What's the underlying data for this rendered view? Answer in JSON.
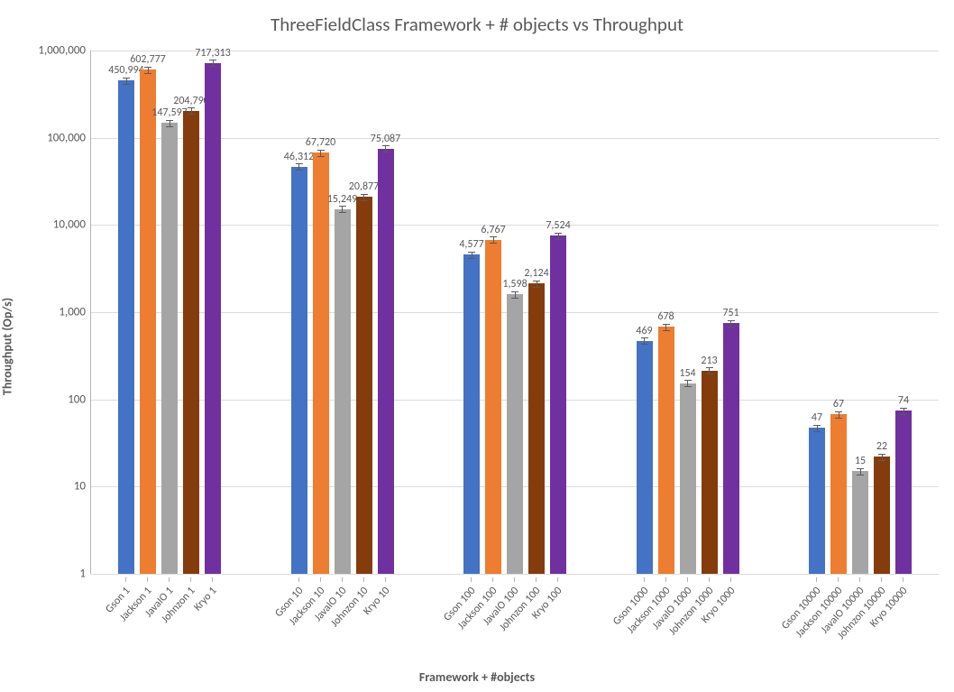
{
  "chart_data": {
    "type": "bar",
    "title": "ThreeFieldClass Framework + # objects vs Throughput",
    "xlabel": "Framework + #objects",
    "ylabel": "Throughput (Op/s)",
    "y_scale": "log",
    "ylim": [
      1,
      1000000
    ],
    "y_ticks": [
      {
        "v": 1,
        "label": "1"
      },
      {
        "v": 10,
        "label": "10"
      },
      {
        "v": 100,
        "label": "100"
      },
      {
        "v": 1000,
        "label": "1,000"
      },
      {
        "v": 10000,
        "label": "10,000"
      },
      {
        "v": 100000,
        "label": "100,000"
      },
      {
        "v": 1000000,
        "label": "1,000,000"
      }
    ],
    "frameworks": [
      "Gson",
      "Jackson",
      "JavaIO",
      "Johnzon",
      "Kryo"
    ],
    "colors": {
      "Gson": "#4472c4",
      "Jackson": "#ed7d31",
      "JavaIO": "#a5a5a5",
      "Johnzon": "#843c0c",
      "Kryo": "#7030a0"
    },
    "object_counts": [
      "1",
      "10",
      "100",
      "1000",
      "10000"
    ],
    "groups": [
      {
        "suffix": "1",
        "bars": [
          {
            "fw": "Gson",
            "value": 450994,
            "label": "450,994"
          },
          {
            "fw": "Jackson",
            "value": 602777,
            "label": "602,777"
          },
          {
            "fw": "JavaIO",
            "value": 147597,
            "label": "147,597"
          },
          {
            "fw": "Johnzon",
            "value": 204790,
            "label": "204,790"
          },
          {
            "fw": "Kryo",
            "value": 717313,
            "label": "717,313"
          }
        ]
      },
      {
        "suffix": "10",
        "bars": [
          {
            "fw": "Gson",
            "value": 46312,
            "label": "46,312"
          },
          {
            "fw": "Jackson",
            "value": 67720,
            "label": "67,720"
          },
          {
            "fw": "JavaIO",
            "value": 15249,
            "label": "15,249"
          },
          {
            "fw": "Johnzon",
            "value": 20877,
            "label": "20,877"
          },
          {
            "fw": "Kryo",
            "value": 75087,
            "label": "75,087"
          }
        ]
      },
      {
        "suffix": "100",
        "bars": [
          {
            "fw": "Gson",
            "value": 4577,
            "label": "4,577"
          },
          {
            "fw": "Jackson",
            "value": 6767,
            "label": "6,767"
          },
          {
            "fw": "JavaIO",
            "value": 1598,
            "label": "1,598"
          },
          {
            "fw": "Johnzon",
            "value": 2124,
            "label": "2,124"
          },
          {
            "fw": "Kryo",
            "value": 7524,
            "label": "7,524"
          }
        ]
      },
      {
        "suffix": "1000",
        "bars": [
          {
            "fw": "Gson",
            "value": 469,
            "label": "469"
          },
          {
            "fw": "Jackson",
            "value": 678,
            "label": "678"
          },
          {
            "fw": "JavaIO",
            "value": 154,
            "label": "154"
          },
          {
            "fw": "Johnzon",
            "value": 213,
            "label": "213"
          },
          {
            "fw": "Kryo",
            "value": 751,
            "label": "751"
          }
        ]
      },
      {
        "suffix": "10000",
        "bars": [
          {
            "fw": "Gson",
            "value": 47,
            "label": "47"
          },
          {
            "fw": "Jackson",
            "value": 67,
            "label": "67"
          },
          {
            "fw": "JavaIO",
            "value": 15,
            "label": "15"
          },
          {
            "fw": "Johnzon",
            "value": 22,
            "label": "22"
          },
          {
            "fw": "Kryo",
            "value": 74,
            "label": "74"
          }
        ]
      }
    ]
  }
}
